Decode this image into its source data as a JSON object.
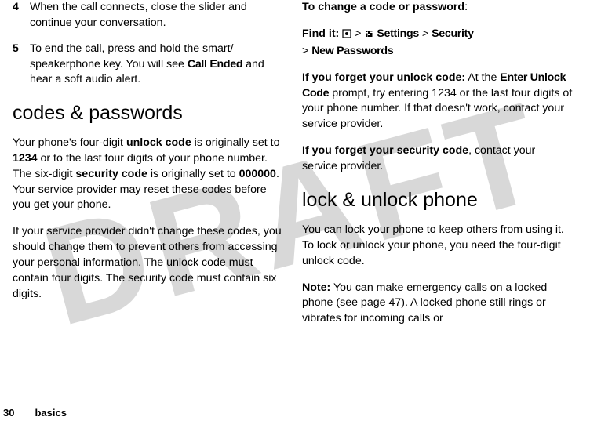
{
  "watermark": "DRAFT",
  "left": {
    "step4": {
      "num": "4",
      "text_a": "When the call connects, close the slider and continue your conversation."
    },
    "step5": {
      "num": "5",
      "text_a": "To end the call, press and hold the smart/ speakerphone key. You will see ",
      "call_ended": "Call Ended",
      "text_b": " and hear a soft audio alert."
    },
    "heading1": "codes & passwords",
    "para1": {
      "a": "Your phone's four-digit ",
      "b": "unlock code",
      "c": " is originally set to ",
      "d": "1234",
      "e": " or to the last four digits of your phone number. The six-digit ",
      "f": "security code",
      "g": " is originally set to ",
      "h": "000000",
      "i": ". Your service provider may reset these codes before you get your phone."
    },
    "para2": "If your service provider didn't change these codes, you should change them to prevent others from accessing your personal information. The unlock code must contain four digits. The security code must contain six digits."
  },
  "right": {
    "change_line1": "To change a code or password",
    "findit_label": "Find it: ",
    "findit_sep": " > ",
    "findit_settings": "Settings",
    "findit_security": "Security",
    "findit_newpw": "New Passwords",
    "forgot_unlock": {
      "a": "If you forget your unlock code:",
      "b": " At the ",
      "c": "Enter Unlock Code",
      "d": " prompt, try entering 1234 or the last four digits of your phone number. If that doesn't work, contact your service provider."
    },
    "forgot_sec": {
      "a": "If you forget your security code",
      "b": ", contact your service provider."
    },
    "heading2": "lock & unlock phone",
    "para3": "You can lock your phone to keep others from using it. To lock or unlock your phone, you need the four-digit unlock code.",
    "para4": {
      "a": "Note:",
      "b": " You can make emergency calls on a locked phone (see page 47). A locked phone still rings or vibrates for incoming calls or"
    }
  },
  "footer": {
    "pagenum": "30",
    "section": "basics"
  }
}
